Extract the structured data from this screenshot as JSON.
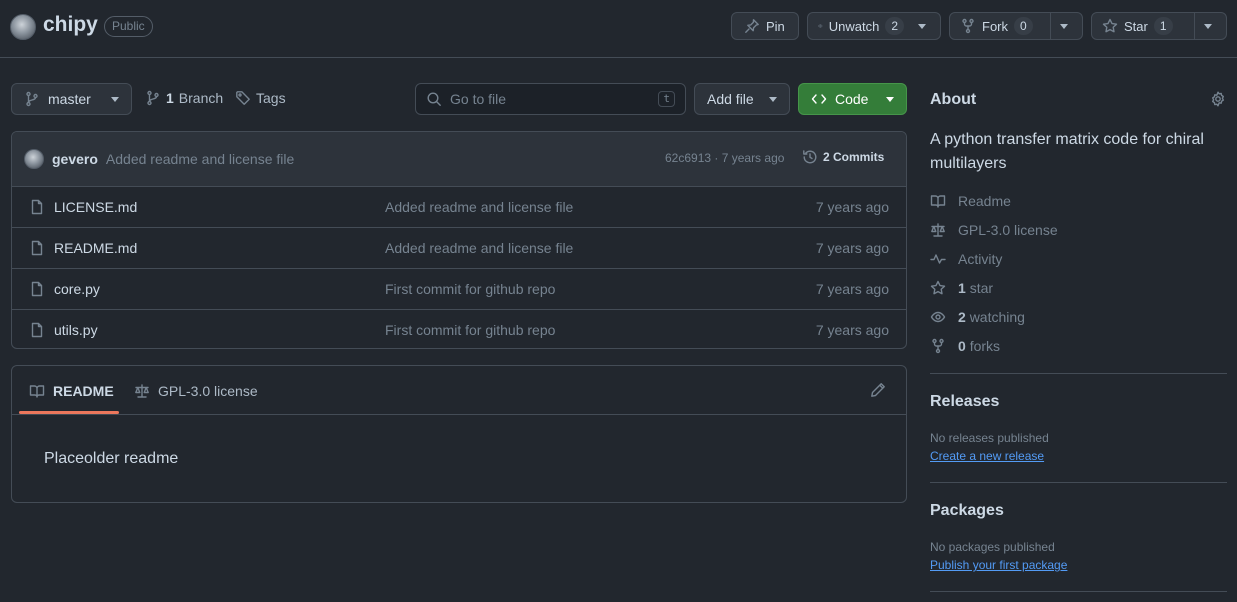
{
  "repo": {
    "name": "chipy",
    "visibility": "Public"
  },
  "actions": {
    "pin_label": "Pin",
    "watch_label": "Unwatch",
    "watch_count": "2",
    "fork_label": "Fork",
    "fork_count": "0",
    "star_label": "Star",
    "star_count": "1"
  },
  "toolbar": {
    "branch": "master",
    "branch_count": "1",
    "branch_word": "Branch",
    "tags_label": "Tags",
    "search_placeholder": "Go to file",
    "search_shortcut": "t",
    "add_file_label": "Add file",
    "code_label": "Code"
  },
  "last_commit": {
    "author": "gevero",
    "message": "Added readme and license file",
    "meta": "62c6913 · 7 years ago",
    "commits_label": "2 Commits"
  },
  "files": [
    {
      "name": "LICENSE.md",
      "message": "Added readme and license file",
      "time": "7 years ago"
    },
    {
      "name": "README.md",
      "message": "Added readme and license file",
      "time": "7 years ago"
    },
    {
      "name": "core.py",
      "message": "First commit for github repo",
      "time": "7 years ago"
    },
    {
      "name": "utils.py",
      "message": "First commit for github repo",
      "time": "7 years ago"
    }
  ],
  "readme": {
    "tab_readme": "README",
    "tab_license": "GPL-3.0 license",
    "content": "Placeolder readme"
  },
  "about": {
    "title": "About",
    "description": "A python transfer matrix code for chiral multilayers",
    "readme_label": "Readme",
    "license_label": "GPL-3.0 license",
    "activity_label": "Activity",
    "stars_count": "1",
    "stars_label": "star",
    "watching_count": "2",
    "watching_label": "watching",
    "forks_count": "0",
    "forks_label": "forks"
  },
  "releases": {
    "title": "Releases",
    "status": "No releases published",
    "link": "Create a new release"
  },
  "packages": {
    "title": "Packages",
    "status": "No packages published",
    "link": "Publish your first package"
  }
}
